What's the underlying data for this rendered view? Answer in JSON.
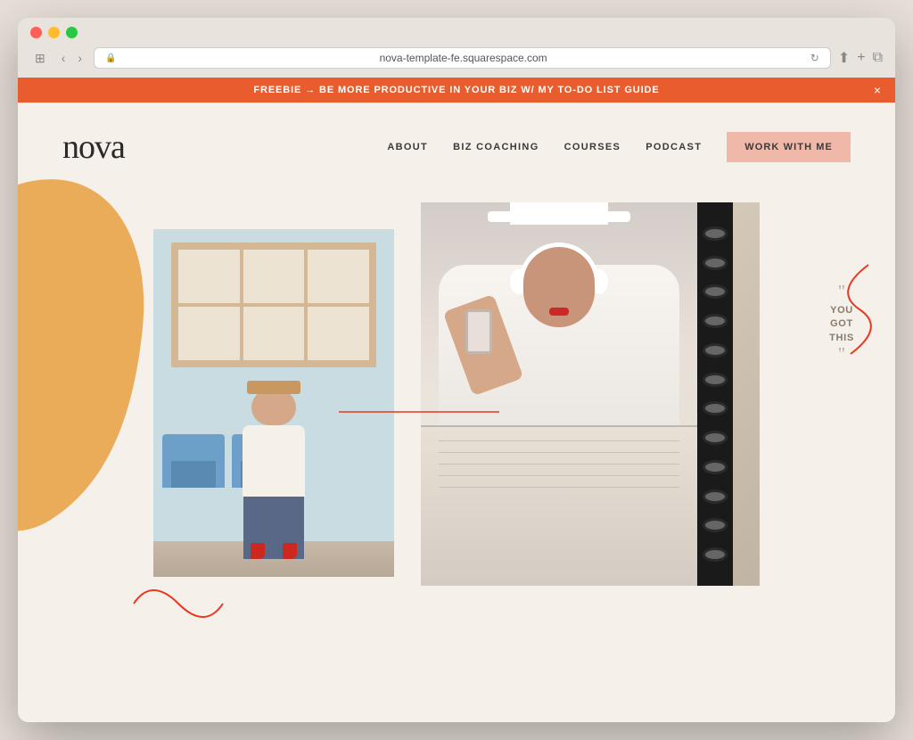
{
  "browser": {
    "address": "nova-template-fe.squarespace.com",
    "nav_back": "‹",
    "nav_forward": "›",
    "sidebar_icon": "⊞",
    "reload_icon": "↻",
    "share_icon": "⬆",
    "new_tab_icon": "+",
    "duplicate_icon": "⧉"
  },
  "banner": {
    "text": "FREEBIE → BE MORE PRODUCTIVE IN YOUR BIZ W/ MY TO-DO LIST GUIDE",
    "close": "×"
  },
  "site": {
    "logo": "nova",
    "nav": {
      "about": "ABOUT",
      "biz_coaching": "BIZ COACHING",
      "courses": "COURSES",
      "podcast": "PODCAST",
      "cta": "WORK WITH ME"
    },
    "quote": {
      "open_mark": "\"",
      "line1": "YOU",
      "line2": "GOT",
      "line3": "THIS",
      "close_mark": "\""
    }
  }
}
